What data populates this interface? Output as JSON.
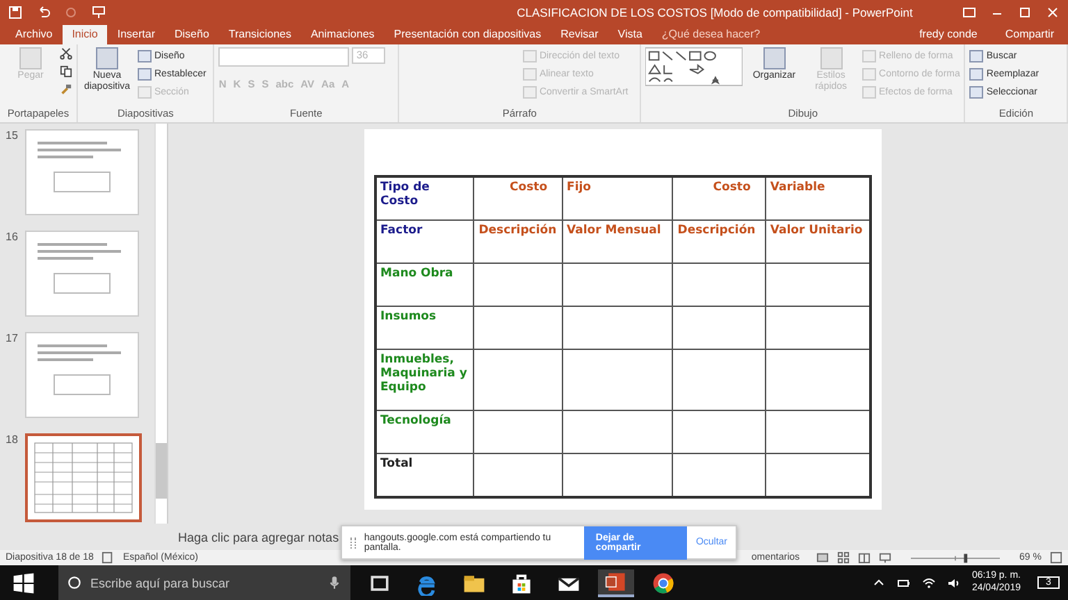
{
  "title_bar": {
    "title": "CLASIFICACION DE LOS COSTOS [Modo de compatibilidad] - PowerPoint"
  },
  "tabs": [
    {
      "label": "Archivo",
      "selected": false
    },
    {
      "label": "Inicio",
      "selected": true
    },
    {
      "label": "Insertar",
      "selected": false
    },
    {
      "label": "Diseño",
      "selected": false
    },
    {
      "label": "Transiciones",
      "selected": false
    },
    {
      "label": "Animaciones",
      "selected": false
    },
    {
      "label": "Presentación con diapositivas",
      "selected": false
    },
    {
      "label": "Revisar",
      "selected": false
    },
    {
      "label": "Vista",
      "selected": false
    }
  ],
  "tell_me": "¿Qué desea hacer?",
  "user": "fredy conde",
  "share": "Compartir",
  "ribbon": [
    {
      "label": "Portapapeles",
      "items": [
        {
          "kind": "big",
          "label": "Pegar",
          "disabled": true
        }
      ]
    },
    {
      "label": "Diapositivas",
      "items": [
        {
          "kind": "big",
          "label": "Nueva diapositiva",
          "disabled": false
        },
        {
          "kind": "small",
          "label": "Diseño",
          "disabled": false
        },
        {
          "kind": "small",
          "label": "Restablecer",
          "disabled": false
        },
        {
          "kind": "small",
          "label": "Sección",
          "disabled": true
        }
      ]
    },
    {
      "label": "Fuente",
      "items": [
        {
          "kind": "combo",
          "label": "36",
          "disabled": true
        },
        {
          "kind": "glyphs",
          "glyphs": [
            "N",
            "K",
            "S",
            "S",
            "abc",
            "AV",
            "Aa",
            "A"
          ],
          "disabled": true
        }
      ]
    },
    {
      "label": "Párrafo",
      "items": [
        {
          "kind": "small",
          "label": "Dirección del texto",
          "disabled": true
        },
        {
          "kind": "small",
          "label": "Alinear texto",
          "disabled": true
        },
        {
          "kind": "small",
          "label": "Convertir a SmartArt",
          "disabled": true
        }
      ]
    },
    {
      "label": "Dibujo",
      "items": [
        {
          "kind": "gallery",
          "disabled": false
        },
        {
          "kind": "big",
          "label": "Organizar",
          "disabled": false
        },
        {
          "kind": "big",
          "label": "Estilos rápidos",
          "disabled": true
        },
        {
          "kind": "small",
          "label": "Relleno de forma",
          "disabled": true
        },
        {
          "kind": "small",
          "label": "Contorno de forma",
          "disabled": true
        },
        {
          "kind": "small",
          "label": "Efectos de forma",
          "disabled": true
        }
      ]
    },
    {
      "label": "Edición",
      "items": [
        {
          "kind": "small",
          "label": "Buscar",
          "disabled": false
        },
        {
          "kind": "small",
          "label": "Reemplazar",
          "disabled": false
        },
        {
          "kind": "small",
          "label": "Seleccionar",
          "disabled": false
        }
      ]
    }
  ],
  "slides": [
    {
      "number": "15",
      "selected": false
    },
    {
      "number": "16",
      "selected": false
    },
    {
      "number": "17",
      "selected": false
    },
    {
      "number": "18",
      "selected": true
    }
  ],
  "table": {
    "header_rows": [
      [
        {
          "text": "Tipo de Costo",
          "color": "#1c1c8c"
        },
        {
          "text": "Costo",
          "color": "#c5501c"
        },
        {
          "text": "Fijo",
          "color": "#c5501c"
        },
        {
          "text": "Costo",
          "color": "#c5501c"
        },
        {
          "text": "Variable",
          "color": "#c5501c"
        }
      ],
      [
        {
          "text": "Factor",
          "color": "#1c1c8c"
        },
        {
          "text": "Descripción",
          "color": "#c5501c"
        },
        {
          "text": "Valor Mensual",
          "color": "#c5501c"
        },
        {
          "text": "Descripción",
          "color": "#c5501c"
        },
        {
          "text": "Valor Unitario",
          "color": "#c5501c"
        }
      ]
    ],
    "rows": [
      {
        "label": "Mano Obra",
        "color": "#1e8a1e"
      },
      {
        "label": "Insumos",
        "color": "#1e8a1e"
      },
      {
        "label": "Inmuebles, Maquinaria y Equipo",
        "color": "#1e8a1e"
      },
      {
        "label": "Tecnología",
        "color": "#1e8a1e"
      },
      {
        "label": "Total",
        "color": "#222222"
      }
    ]
  },
  "notes": {
    "placeholder": "Haga clic para agregar notas"
  },
  "share_bar": {
    "text": "hangouts.google.com está compartiendo tu pantalla.",
    "button": "Dejar de compartir",
    "link": "Ocultar"
  },
  "status_bar": {
    "slide": "Diapositiva 18 de 18",
    "language": "Español (México)",
    "comments": "omentarios",
    "zoom": "69 %",
    "zoom_slider": {
      "level": 0.62
    }
  },
  "taskbar": {
    "search": "Escribe aquí para buscar",
    "time": "06:19 p. m.",
    "date": "24/04/2019",
    "notifications": "3"
  }
}
